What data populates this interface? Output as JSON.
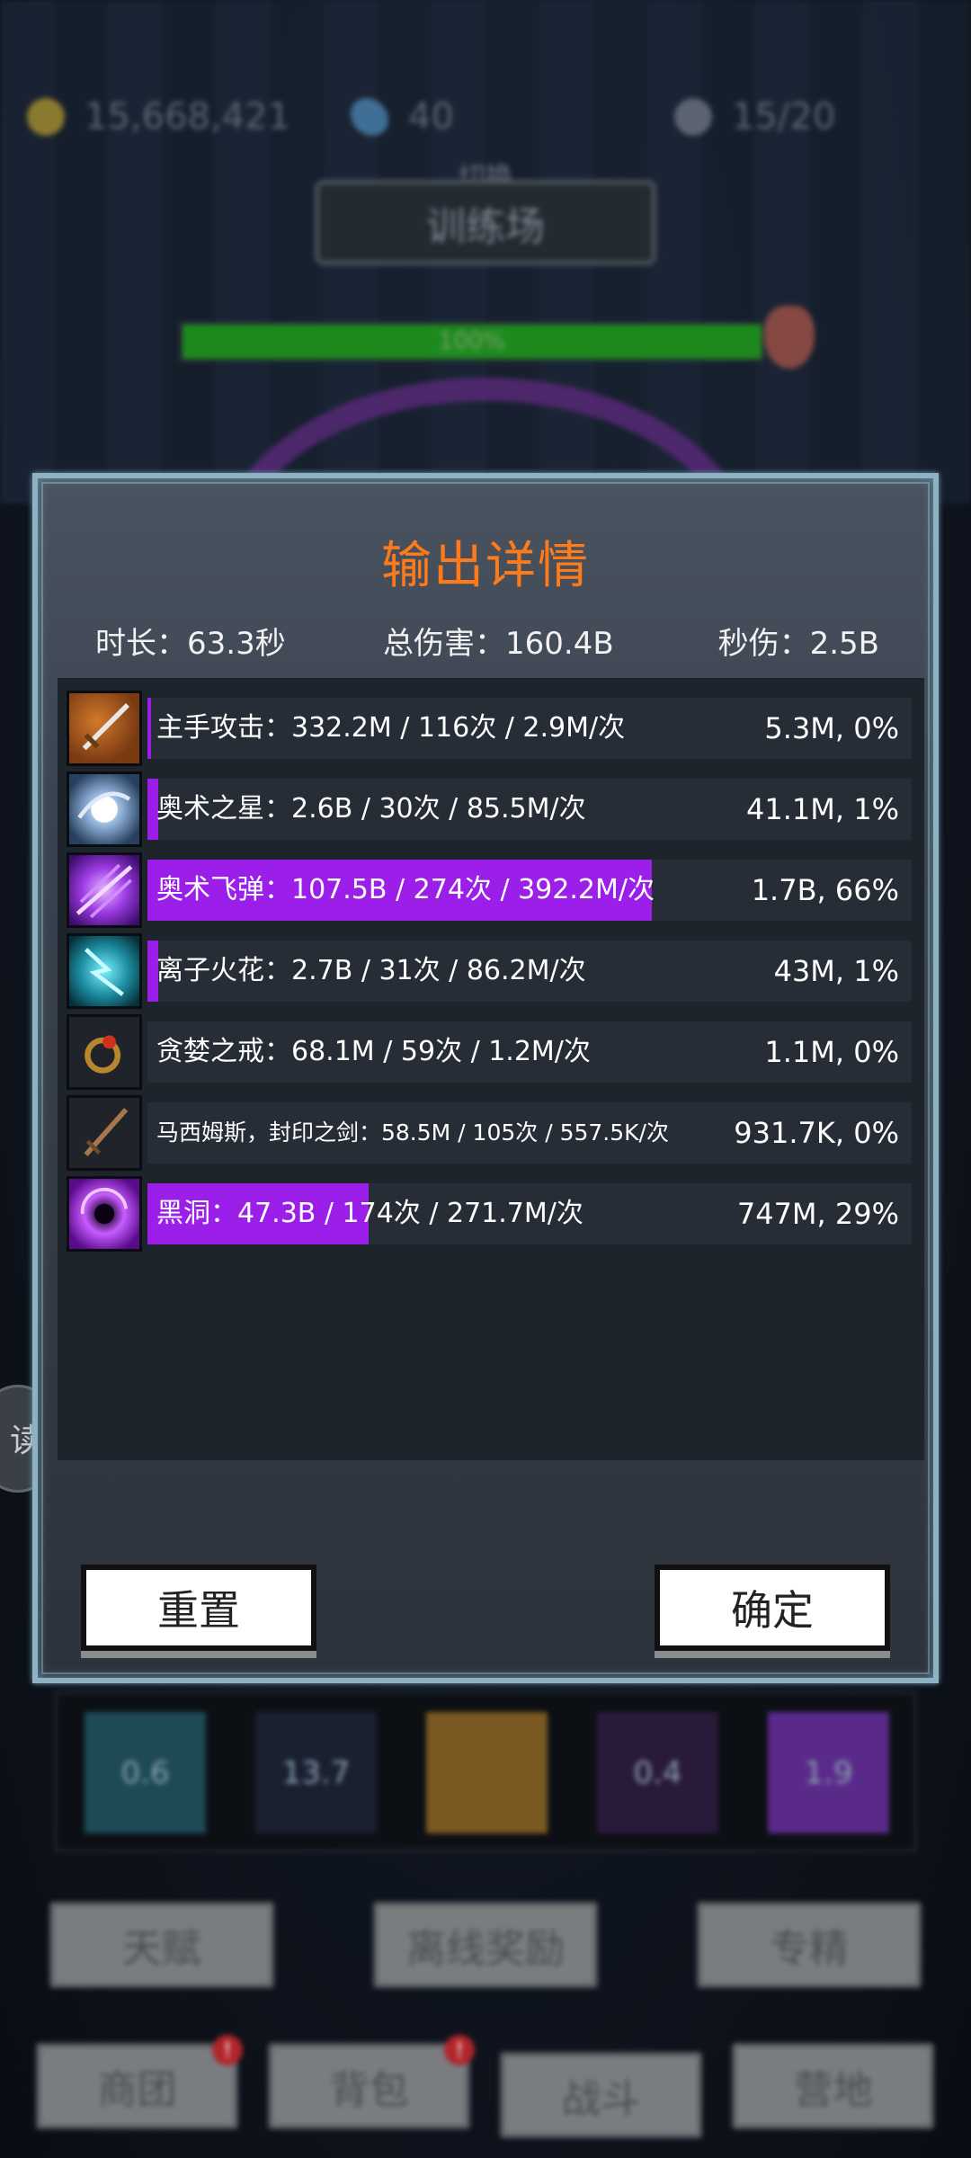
{
  "background": {
    "resources": {
      "gold": "15,668,421",
      "gems": "40",
      "keys": "15/20"
    },
    "switch_label": "切换",
    "stage_name": "训练场",
    "hp": {
      "text": "100%",
      "fraction": 1.0
    },
    "skill_slots": [
      "0.6",
      "13.7",
      "",
      "0.4",
      "1.9"
    ],
    "side_read_label": "读",
    "row_buttons": [
      "天赋",
      "离线奖励",
      "专精"
    ],
    "nav_buttons": [
      {
        "label": "商团",
        "badge": "!"
      },
      {
        "label": "背包",
        "badge": "!"
      },
      {
        "label": "战斗",
        "badge": ""
      },
      {
        "label": "营地",
        "badge": ""
      }
    ]
  },
  "modal": {
    "title": "输出详情",
    "stats": {
      "duration": "时长：63.3秒",
      "total_damage": "总伤害：160.4B",
      "dps": "秒伤：2.5B"
    },
    "rows": [
      {
        "icon": "sword-icon",
        "text": "主手攻击：332.2M  /  116次  /  2.9M/次",
        "right": "5.3M, 0%",
        "fill": 0.004
      },
      {
        "icon": "arcane-star-icon",
        "text": "奥术之星：2.6B  /  30次  /  85.5M/次",
        "right": "41.1M, 1%",
        "fill": 0.016
      },
      {
        "icon": "arcane-missile-icon",
        "text": "奥术飞弹：107.5B  /  274次  /  392.2M/次",
        "right": "1.7B, 66%",
        "fill": 0.66
      },
      {
        "icon": "ion-spark-icon",
        "text": "离子火花：2.7B  /  31次  /  86.2M/次",
        "right": "43M, 1%",
        "fill": 0.013
      },
      {
        "icon": "greed-ring-icon",
        "text": "贪婪之戒：68.1M  /  59次  /  1.2M/次",
        "right": "1.1M, 0%",
        "fill": 0
      },
      {
        "icon": "sealed-sword-icon",
        "text": "马西姆斯，封印之剑：58.5M  /  105次  /  557.5K/次",
        "right": "931.7K, 0%",
        "fill": 0
      },
      {
        "icon": "black-hole-icon",
        "text": "黑洞：47.3B  /  174次  /  271.7M/次",
        "right": "747M, 29%",
        "fill": 0.29
      }
    ],
    "reset_label": "重置",
    "confirm_label": "确定"
  }
}
